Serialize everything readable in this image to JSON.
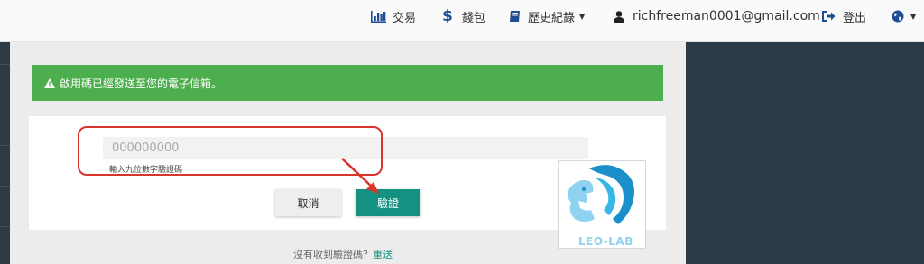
{
  "nav": {
    "trade_label": "交易",
    "wallet_label": "錢包",
    "history_label": "歷史紀錄",
    "user_email": "richfreeman0001@gmail.com",
    "logout_label": "登出",
    "icons": {
      "trade": "bar-chart-icon",
      "wallet": "dollar-icon",
      "history": "book-icon",
      "user": "user-icon",
      "logout": "sign-out-icon",
      "language": "globe-icon"
    }
  },
  "alert": {
    "message": "啟用碼已經發送至您的電子信箱。",
    "icon": "warning-icon",
    "color": "#4cae4c"
  },
  "form": {
    "code_placeholder": "000000000",
    "hint": "輸入九位數字驗證碼",
    "cancel_label": "取消",
    "verify_label": "驗證",
    "verify_color": "#149181"
  },
  "logo": {
    "text": "LEO-LAB"
  },
  "footer": {
    "question": "沒有收到驗證碼？",
    "resend_label": "重送"
  }
}
